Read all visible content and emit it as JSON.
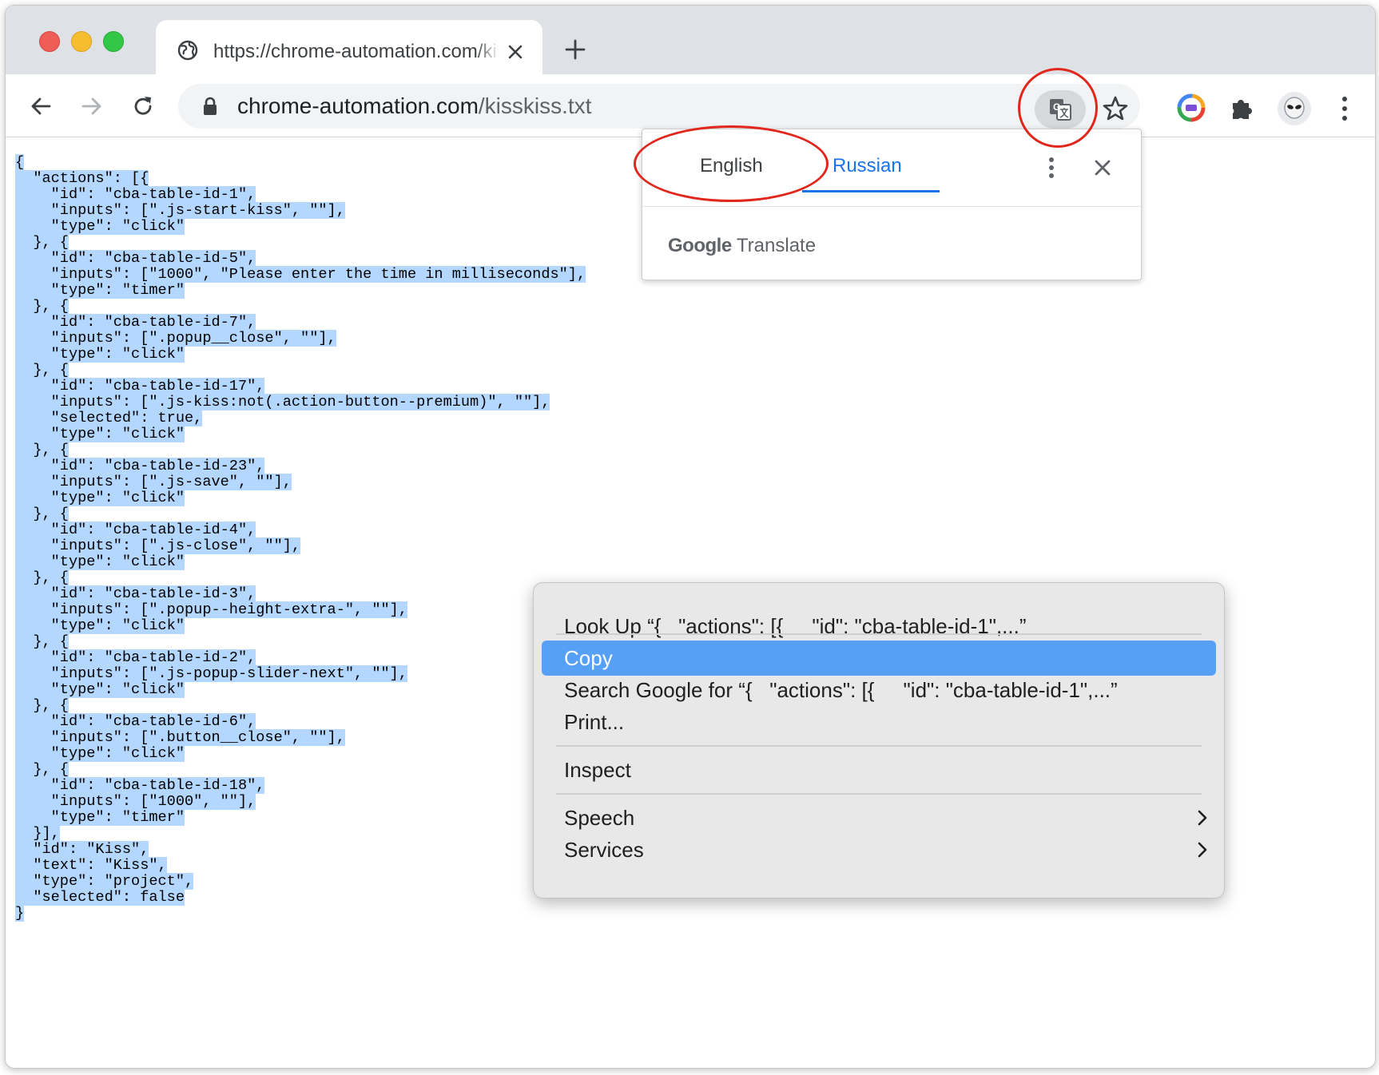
{
  "tab": {
    "title": "https://chrome-automation.com/kisskiss.txt"
  },
  "address": {
    "domain": "chrome-automation.com",
    "path": "/kisskiss.txt"
  },
  "document": {
    "lines": [
      "{",
      "  \"actions\": [{",
      "    \"id\": \"cba-table-id-1\",",
      "    \"inputs\": [\".js-start-kiss\", \"\"],",
      "    \"type\": \"click\"",
      "  }, {",
      "    \"id\": \"cba-table-id-5\",",
      "    \"inputs\": [\"1000\", \"Please enter the time in milliseconds\"],",
      "    \"type\": \"timer\"",
      "  }, {",
      "    \"id\": \"cba-table-id-7\",",
      "    \"inputs\": [\".popup__close\", \"\"],",
      "    \"type\": \"click\"",
      "  }, {",
      "    \"id\": \"cba-table-id-17\",",
      "    \"inputs\": [\".js-kiss:not(.action-button--premium)\", \"\"],",
      "    \"selected\": true,",
      "    \"type\": \"click\"",
      "  }, {",
      "    \"id\": \"cba-table-id-23\",",
      "    \"inputs\": [\".js-save\", \"\"],",
      "    \"type\": \"click\"",
      "  }, {",
      "    \"id\": \"cba-table-id-4\",",
      "    \"inputs\": [\".js-close\", \"\"],",
      "    \"type\": \"click\"",
      "  }, {",
      "    \"id\": \"cba-table-id-3\",",
      "    \"inputs\": [\".popup--height-extra-\", \"\"],",
      "    \"type\": \"click\"",
      "  }, {",
      "    \"id\": \"cba-table-id-2\",",
      "    \"inputs\": [\".js-popup-slider-next\", \"\"],",
      "    \"type\": \"click\"",
      "  }, {",
      "    \"id\": \"cba-table-id-6\",",
      "    \"inputs\": [\".button__close\", \"\"],",
      "    \"type\": \"click\"",
      "  }, {",
      "    \"id\": \"cba-table-id-18\",",
      "    \"inputs\": [\"1000\", \"\"],",
      "    \"type\": \"timer\"",
      "  }],",
      "  \"id\": \"Kiss\",",
      "  \"text\": \"Kiss\",",
      "  \"type\": \"project\",",
      "  \"selected\": false",
      "}"
    ]
  },
  "translate_popup": {
    "source_lang": "English",
    "target_lang": "Russian",
    "brand_google": "Google",
    "brand_translate": "Translate"
  },
  "context_menu": {
    "look_up": "Look Up “{   \"actions\": [{     \"id\": \"cba-table-id-1\",...”",
    "copy": "Copy",
    "search_google": "Search Google for “{   \"actions\": [{     \"id\": \"cba-table-id-1\",...”",
    "print": "Print...",
    "inspect": "Inspect",
    "speech": "Speech",
    "services": "Services"
  },
  "colors": {
    "selection": "#b3d7ff",
    "menu_highlight": "#57a0f8",
    "link_blue": "#1a73e8",
    "annotation_red": "#e1261c"
  }
}
